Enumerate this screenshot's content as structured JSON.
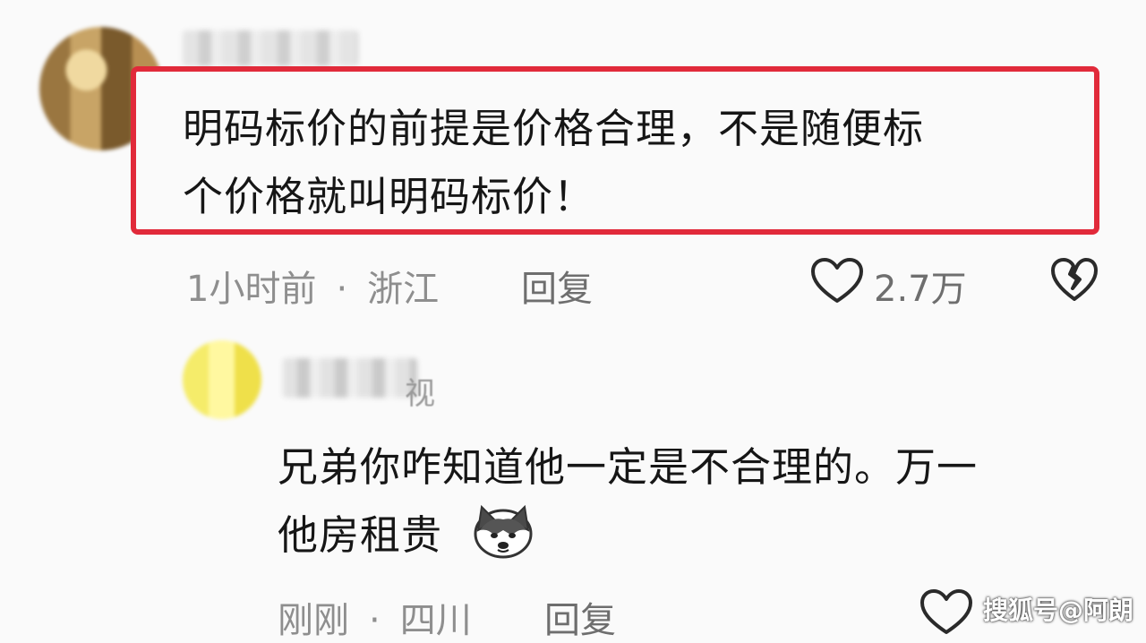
{
  "comments": [
    {
      "text_line1": "明码标价的前提是价格合理，不是随便标",
      "text_line2": "个价格就叫明码标价！",
      "time": "1小时前",
      "location": "浙江",
      "reply_label": "回复",
      "likes": "2.7万"
    },
    {
      "username_suffix": "视",
      "text_line1": "兄弟你咋知道他一定是不合理的。万一",
      "text_line2": "他房租贵",
      "emoji_icon": "husky-dog-emoji",
      "time": "刚刚",
      "location": "四川",
      "reply_label": "回复"
    }
  ],
  "watermark": "搜狐号@阿朗",
  "colors": {
    "highlight_border": "#e12a3a",
    "meta_text": "#8e8e8e",
    "background": "#fafafa"
  }
}
